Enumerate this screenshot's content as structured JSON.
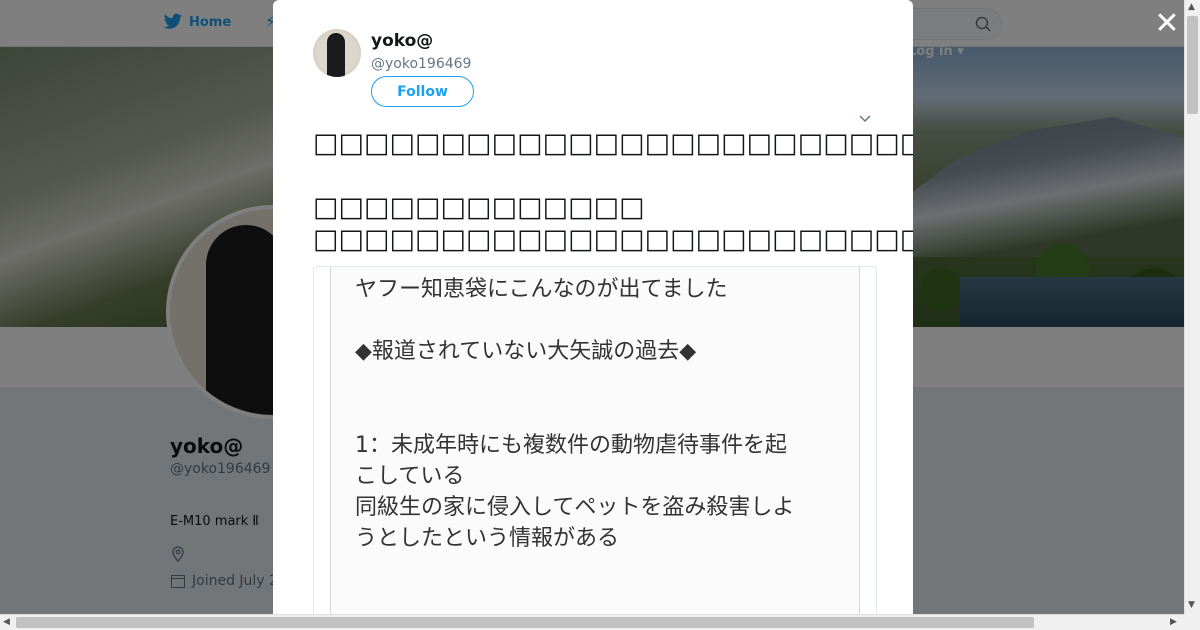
{
  "nav": {
    "home_label": "Home",
    "login_label": "Log in"
  },
  "profile": {
    "name": "yoko@",
    "handle": "@yoko196469",
    "bio": "E-M10 mark Ⅱ",
    "joined": "Joined July 2"
  },
  "tweet": {
    "name": "yoko@",
    "handle": "@yoko196469",
    "follow_label": "Follow",
    "text": "□□□□□□□□□□□□□□□□□□□□□□□□□\n\n□□□□□□□□□□□□□\n□□□□□□□□□□□□□□□□□□□□□□□□□□□□□□□□□",
    "media_lines": [
      "ヤフー知恵袋にこんなのが出てました",
      "◆報道されていない大矢誠の過去◆",
      "1：未成年時にも複数件の動物虐待事件を起",
      "こしている",
      "同級生の家に侵入してペットを盗み殺害しよ",
      "うとしたという情報がある"
    ]
  },
  "icons": {
    "close": "close-icon",
    "twitter": "twitter-bird-icon",
    "search": "search-icon",
    "chevron": "chevron-down-icon"
  },
  "colors": {
    "accent": "#1da1f2",
    "overlay": "rgba(0,0,0,0.5)"
  }
}
